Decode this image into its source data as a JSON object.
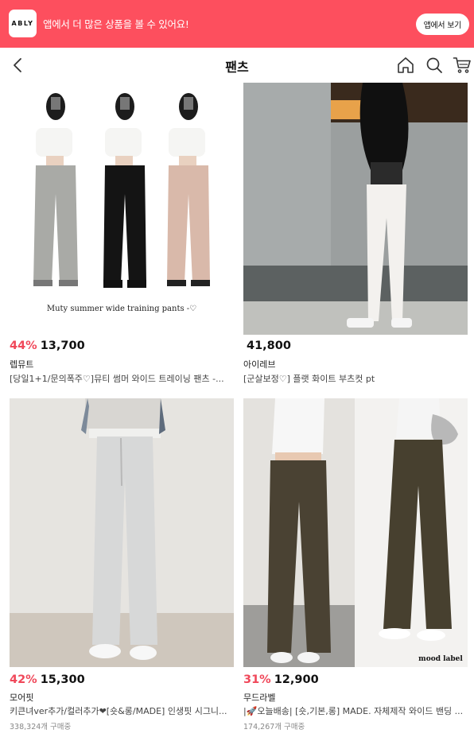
{
  "banner": {
    "logo": "ABLY",
    "message": "앱에서 더 많은 상품을 볼 수 있어요!",
    "button": "앱에서 보기"
  },
  "header": {
    "title": "팬츠",
    "icons": [
      "back-arrow-icon",
      "home-icon",
      "search-icon",
      "cart-icon"
    ]
  },
  "products": [
    {
      "discount": "44%",
      "price": "13,700",
      "brand": "렙뮤트",
      "name": "[당일1+1/문의폭주♡]뮤티 썸머 와이드 트레이닝 팬츠 -...",
      "sales": "",
      "image_caption": "Muty summer wide training pants -♡"
    },
    {
      "discount": "",
      "price": "41,800",
      "brand": "아이레브",
      "name": "[군살보정♡] 플랫 화이트 부츠컷 pt",
      "sales": "",
      "image_caption": ""
    },
    {
      "discount": "42%",
      "price": "15,300",
      "brand": "모어핏",
      "name": "키큰녀ver추가/컬러추가❤[숏&롱/MADE] 인생핏 시그니...",
      "sales": "338,324개 구매중",
      "image_caption": ""
    },
    {
      "discount": "31%",
      "price": "12,900",
      "brand": "무드라벨",
      "name": "|🚀오늘배송| [숏,기본,롱] MADE. 자체제작 와이드 밴딩 ...",
      "sales": "174,267개 구매중",
      "image_caption": "mood label"
    }
  ],
  "colors": {
    "brand": "#fd4f5e",
    "discount": "#f0485a"
  }
}
